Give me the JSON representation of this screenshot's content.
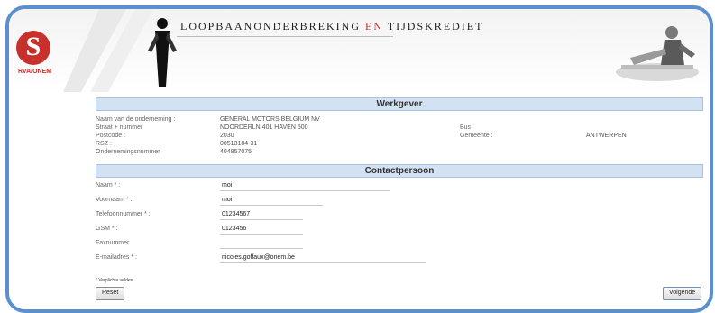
{
  "header": {
    "logo_text": "RVA/ONEM",
    "title_parts": [
      "LOOPBAANONDERBREKING ",
      "EN",
      " TIJDSKREDIET"
    ]
  },
  "werkgever": {
    "title": "Werkgever",
    "rows": [
      {
        "label": "Naam van de onderneming :",
        "value": "GENERAL MOTORS BELGIUM NV"
      },
      {
        "label": "Straat + nummer",
        "value": "NOORDERLN 401 HAVEN 500"
      },
      {
        "label": "Postcode :",
        "value": "2030"
      },
      {
        "label": "RSZ :",
        "value": "00513184-31"
      },
      {
        "label": "Ondernemingsnummer",
        "value": "404957075"
      }
    ],
    "bus_label": "Bus",
    "gemeente_label": "Gemeente :",
    "gemeente_value": "ANTWERPEN"
  },
  "contactpersoon": {
    "title": "Contactpersoon",
    "fields": [
      {
        "label": "Naam * :",
        "value": "moi"
      },
      {
        "label": "Voornaam * :",
        "value": "moi"
      },
      {
        "label": "Telefoonnummer * :",
        "value": "01234567"
      },
      {
        "label": "GSM * :",
        "value": "0123456"
      },
      {
        "label": "Faxnummer",
        "value": ""
      },
      {
        "label": "E-mailadres * :",
        "value": "nicoles.goffaux@onem.be"
      }
    ],
    "required_note": "* Verplichte velden"
  },
  "buttons": {
    "reset": "Reset",
    "next": "Volgende"
  },
  "colors": {
    "frame": "#5b8fcf",
    "section_bar": "#d3e2f3",
    "brand_red": "#c8302c"
  }
}
